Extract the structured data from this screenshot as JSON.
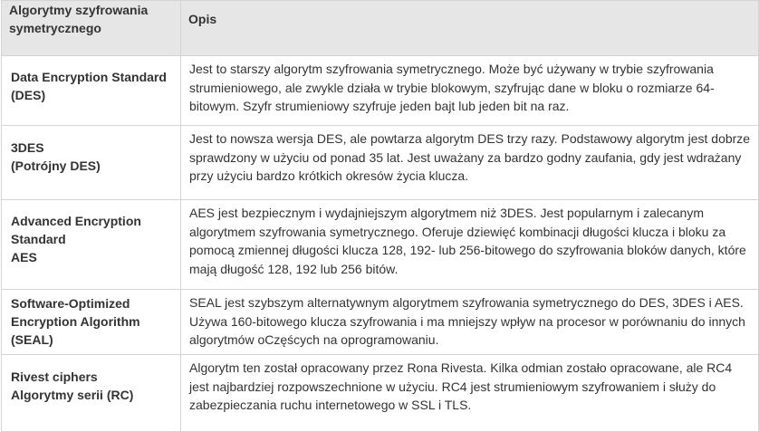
{
  "table": {
    "headers": [
      "Algorytmy szyfrowania symetrycznego",
      "Opis"
    ],
    "rows": [
      {
        "name": [
          "Data Encryption Standard",
          "(DES)"
        ],
        "desc": [
          "Jest to starszy algorytm szyfrowania symetrycznego. Może być używany w trybie szyfrowania strumieniowego, ale zwykle działa w trybie blokowym, szyfrując dane w bloku o rozmiarze 64-bitowym. Szyfr strumieniowy szyfruje jeden bajt lub jeden bit na raz."
        ]
      },
      {
        "name": [
          "3DES",
          "(Potrójny DES)"
        ],
        "desc": [
          "Jest to nowsza wersja DES, ale powtarza algorytm DES trzy razy. Podstawowy algorytm jest dobrze sprawdzony w użyciu od ponad 35 lat. Jest uważany za bardzo godny zaufania, gdy jest wdrażany przy użyciu bardzo krótkich okresów życia klucza."
        ]
      },
      {
        "name": [
          "Advanced Encryption Standard",
          "AES"
        ],
        "desc": [
          "AES jest bezpiecznym i wydajniejszym algorytmem niż 3DES. Jest popularnym i zalecanym algorytmem szyfrowania symetrycznego. Oferuje dziewięć kombinacji długości klucza i bloku za pomocą zmiennej długości klucza 128, 192- lub 256-bitowego do szyfrowania bloków danych, które mają długość 128, 192 lub 256 bitów."
        ]
      },
      {
        "name": [
          "Software-Optimized Encryption Algorithm",
          "(SEAL)"
        ],
        "desc": [
          "SEAL jest szybszym alternatywnym algorytmem szyfrowania symetrycznego do DES, 3DES i AES. Używa 160-bitowego klucza szyfrowania i ma mniejszy wpływ na procesor w porównaniu do innych algorytmów oCzęścych na oprogramowaniu."
        ]
      },
      {
        "name": [
          "Rivest ciphers",
          "Algorytmy serii (RC)"
        ],
        "desc": [
          "Algorytm ten został opracowany przez Rona Rivesta. Kilka odmian zostało opracowane, ale RC4 jest najbardziej rozpowszechnione w użyciu. RC4 jest strumieniowym szyfrowaniem i służy do zabezpieczania ruchu internetowego w SSL i TLS."
        ]
      }
    ]
  }
}
